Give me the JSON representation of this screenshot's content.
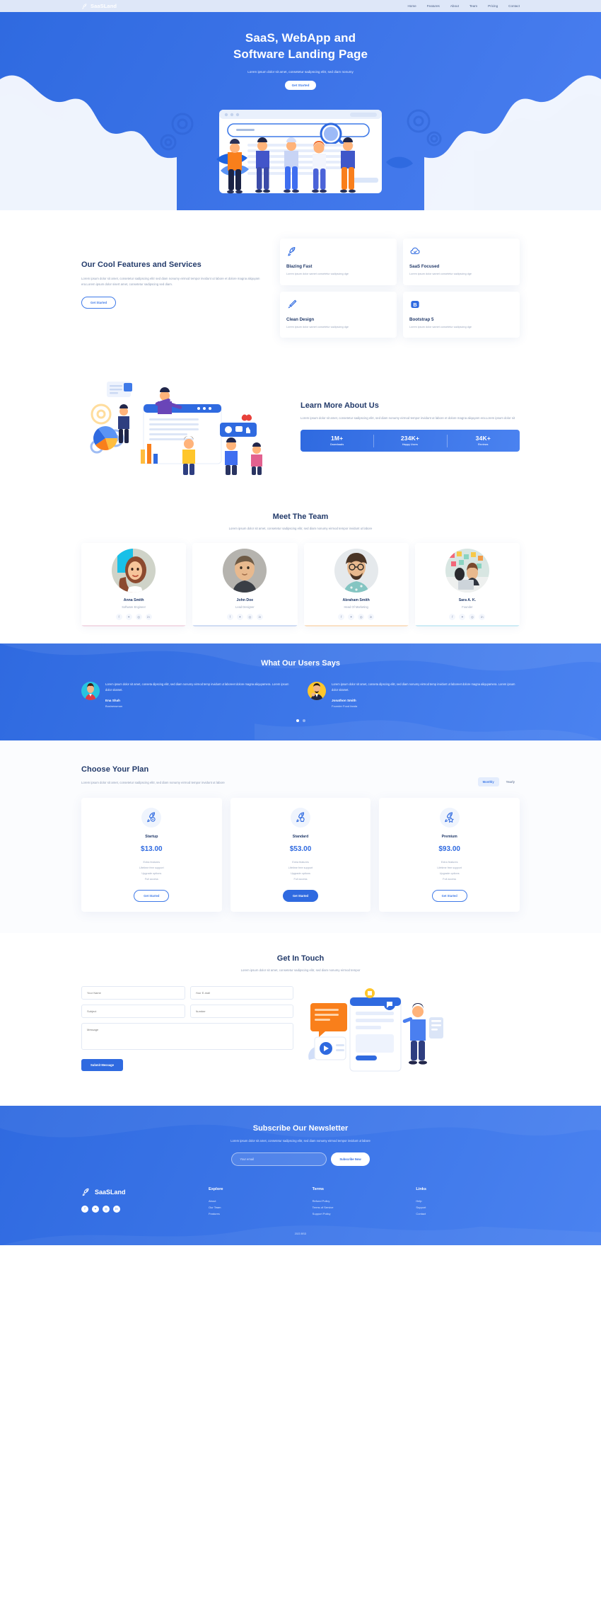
{
  "nav": {
    "brand": "SaaSLand",
    "logo_icon": "rocket-icon",
    "links": [
      "Home",
      "Features",
      "About",
      "Team",
      "Pricing",
      "Contact"
    ]
  },
  "hero": {
    "title_line1": "SaaS, WebApp and",
    "title_line2": "Software Landing Page",
    "subtitle": "Lorem ipsum dolor sit amet, consetetur sadipscing elitr, sed diam nonumy",
    "button": "Get Started"
  },
  "features": {
    "title": "Our Cool Features and Services",
    "text": "Lorem ipsum dolor sit amet, consetetur sadipscing elitr sed diam nonumy eirmod tempor invidunt ut labore et dolore magna aliquyam era.Lorem ipsum dolor sisert amet, consetetur sadipscing sed diam.",
    "button": "Get Started",
    "cards": [
      {
        "icon": "rocket-icon",
        "title": "Blazing Fast",
        "desc": "Lorem ipsum dolor samet consetetur sadipscing dge"
      },
      {
        "icon": "cloud-check-icon",
        "title": "SaaS Focused",
        "desc": "Lorem ipsum dolor samet consetetur sadipscing dge"
      },
      {
        "icon": "paint-brush-icon",
        "title": "Clean Design",
        "desc": "Lorem ipsum dolor samet consetetur sadipscing dge"
      },
      {
        "icon": "bootstrap-icon",
        "title": "Bootstrap 5",
        "desc": "Lorem ipsum dolor samet consetetur sadipscing dge"
      }
    ]
  },
  "about": {
    "title": "Learn More About Us",
    "text": "Lorem ipsum dolor sit amet, consetetur sadipscing elitr, sed diam nonumy eirmod tempor invidunt ut labore et dolore magna aliquyam era.Lorem ipsum dolor sit",
    "stats": [
      {
        "value": "1M+",
        "label": "Downloads"
      },
      {
        "value": "234K+",
        "label": "Happy Users"
      },
      {
        "value": "34K+",
        "label": "Reviews"
      }
    ]
  },
  "team": {
    "title": "Meet The Team",
    "subtitle": "Lorem ipsum dolor sit amet, consetetur sadipscing elitr, sed diam nonumy eirmod tempor invidunt ut labore",
    "members": [
      {
        "name": "Anna Smith",
        "role": "Software Engineer",
        "accent": "#f3dbe6"
      },
      {
        "name": "John Doe",
        "role": "Lead Designer",
        "accent": "#cfdcf3"
      },
      {
        "name": "Abraham Smith",
        "role": "Head Of Marketing",
        "accent": "#fae0c4"
      },
      {
        "name": "Sara A. K.",
        "role": "Founder",
        "accent": "#cdecf5"
      }
    ],
    "social_icons": [
      "facebook-icon",
      "twitter-icon",
      "instagram-icon",
      "linkedin-icon"
    ]
  },
  "testimonials": {
    "title": "What Our Users Says",
    "items": [
      {
        "text": "Lorem ipsum dolor sit amet, conseta dipscing elitr, sed diam nonumy eirmod temp invidunt ut laboreet dolore magna aliquyamera. Lorem ipsum dolor sitamet.",
        "name": "Ena Shah",
        "role": "Businessman",
        "avatar_bg": "#27c3e0"
      },
      {
        "text": "Lorem ipsum dolor sit amet, conseta dipscing elitr, sed diam nonumy eirmod temp invidunt ut laboreet dolore magna aliquyamera. Lorem ipsum dolor sitamet.",
        "name": "Jonathon Smith",
        "role": "Founder Food fanda",
        "avatar_bg": "#ffc62b"
      }
    ],
    "active_dot": 0
  },
  "pricing": {
    "title": "Choose Your Plan",
    "text": "Lorem ipsum dolor sit amet, consetetur sadipscing elitr, sed diam nonumy eirmod tempor invidunt ut labore",
    "toggle": {
      "monthly": "Monthly",
      "yearly": "Yearly",
      "active": "Monthly"
    },
    "plans": [
      {
        "icon": "rocket-target-icon",
        "name": "Startup",
        "price": "$13.00",
        "features": [
          "Extra features",
          "Lifetime free support",
          "Upgrade options",
          "Full access"
        ],
        "button": "Get Started",
        "highlight": false
      },
      {
        "icon": "rocket-bulb-icon",
        "name": "Standard",
        "price": "$53.00",
        "features": [
          "Extra features",
          "Lifetime free support",
          "Upgrade options",
          "Full access"
        ],
        "button": "Get Started",
        "highlight": true
      },
      {
        "icon": "rocket-star-icon",
        "name": "Premium",
        "price": "$93.00",
        "features": [
          "Extra features",
          "Lifetime free support",
          "Upgrade options",
          "Full access"
        ],
        "button": "Get Started",
        "highlight": false
      }
    ]
  },
  "contact": {
    "title": "Get In Touch",
    "subtitle": "Lorem ipsum dolor sit amet, consetetur sadipscing elitr, sed diam nonumy eirmod tempor",
    "fields": {
      "name": "Your Name",
      "email": "Your E-mail",
      "subject": "Subject",
      "number": "Number",
      "message": "Message"
    },
    "button": "Submit Message"
  },
  "newsletter": {
    "title": "Subscribe Our Newsletter",
    "subtitle": "Lorem ipsum dolor sit amet, consetetur sadipscing elitr, sed diam nonumy eirmod tempor invidunt ut labore",
    "placeholder": "Your email",
    "button": "Subscribe Now"
  },
  "footer": {
    "brand": "SaaSLand",
    "socials": [
      "facebook-icon",
      "twitter-icon",
      "instagram-icon",
      "linkedin-icon"
    ],
    "columns": [
      {
        "title": "Explore",
        "links": [
          "About",
          "Our Team",
          "Features"
        ]
      },
      {
        "title": "Terms",
        "links": [
          "Refund Policy",
          "Terms of Service",
          "Support Policy"
        ]
      },
      {
        "title": "Links",
        "links": [
          "Help",
          "Support",
          "Contact"
        ]
      }
    ],
    "copyright": "2023 BSD"
  },
  "colors": {
    "primary": "#2f6ae0",
    "primary_light": "#4a82f0",
    "nav_bg": "#dee7f8",
    "heading": "#223a6a",
    "muted": "#8d9bb5"
  }
}
